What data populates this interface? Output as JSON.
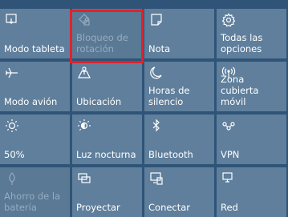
{
  "tiles": [
    {
      "label": "Modo tableta",
      "icon": "tablet-mode-icon",
      "enabled": true
    },
    {
      "label": "Bloqueo de\nrotación",
      "icon": "rotation-lock-icon",
      "enabled": false
    },
    {
      "label": "Nota",
      "icon": "note-icon",
      "enabled": true
    },
    {
      "label": "Todas las\nopciones",
      "icon": "gear-icon",
      "enabled": true
    },
    {
      "label": "Modo avión",
      "icon": "airplane-icon",
      "enabled": true
    },
    {
      "label": "Ubicación",
      "icon": "location-icon",
      "enabled": true
    },
    {
      "label": "Horas de\nsilencio",
      "icon": "moon-icon",
      "enabled": true
    },
    {
      "label": "Zona cubierta\nmóvil",
      "icon": "mobile-hotspot-icon",
      "enabled": true
    },
    {
      "label": "50%",
      "icon": "brightness-icon",
      "enabled": true
    },
    {
      "label": "Luz nocturna",
      "icon": "night-light-icon",
      "enabled": true
    },
    {
      "label": "Bluetooth",
      "icon": "bluetooth-icon",
      "enabled": true
    },
    {
      "label": "VPN",
      "icon": "vpn-icon",
      "enabled": true
    },
    {
      "label": "Ahorro de la\nbatería",
      "icon": "battery-saver-icon",
      "enabled": false
    },
    {
      "label": "Proyectar",
      "icon": "project-icon",
      "enabled": true
    },
    {
      "label": "Conectar",
      "icon": "connect-icon",
      "enabled": true
    },
    {
      "label": "Red",
      "icon": "network-icon",
      "enabled": true
    }
  ],
  "colors": {
    "background": "#2f5477",
    "tile": "#5f7f9c",
    "highlight": "#e0222d"
  }
}
